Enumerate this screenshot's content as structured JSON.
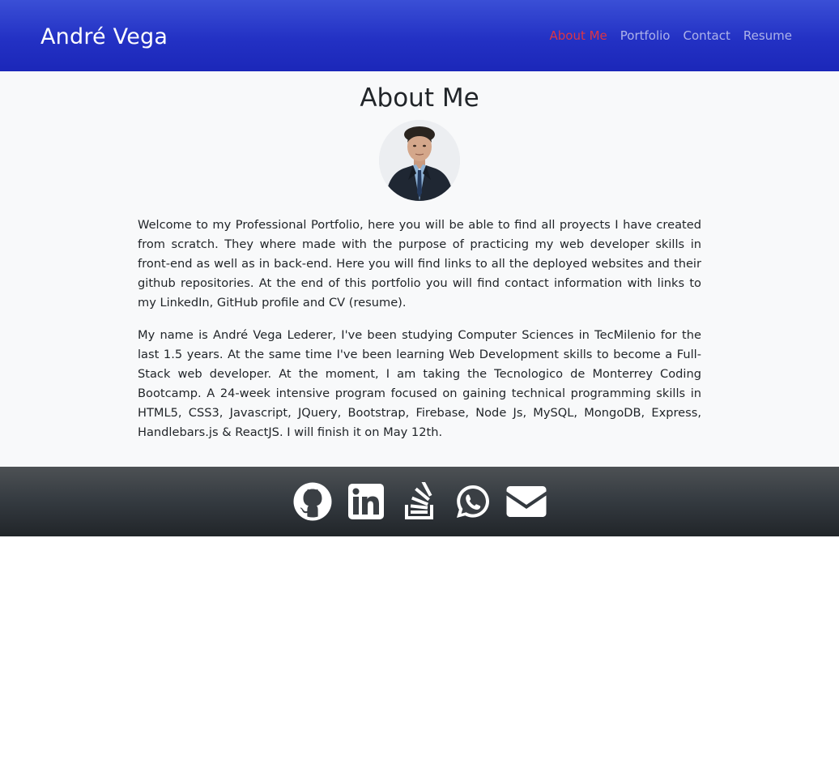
{
  "navbar": {
    "brand": "André Vega",
    "links": [
      {
        "label": "About Me",
        "active": true
      },
      {
        "label": "Portfolio",
        "active": false
      },
      {
        "label": "Contact",
        "active": false
      },
      {
        "label": "Resume",
        "active": false
      }
    ]
  },
  "main": {
    "title": "About Me",
    "avatar_icon": "profile-photo",
    "paragraphs": [
      "Welcome to my Professional Portfolio, here you will be able to find all proyects I have created from scratch. They where made with the purpose of practicing my web developer skills in front-end as well as in back-end. Here you will find links to all the deployed websites and their github repositories. At the end of this portfolio you will find contact information with links to my LinkedIn, GitHub profile and CV (resume).",
      "My name is André Vega Lederer, I've been studying Computer Sciences in TecMilenio for the last 1.5 years. At the same time I've been learning Web Development skills to become a Full-Stack web developer. At the moment, I am taking the Tecnologico de Monterrey Coding Bootcamp. A 24-week intensive program focused on gaining technical programming skills in HTML5, CSS3, Javascript, JQuery, Bootstrap, Firebase, Node Js, MySQL, MongoDB, Express, Handlebars.js & ReactJS. I will finish it on May 12th."
    ]
  },
  "footer": {
    "icons": [
      "github-icon",
      "linkedin-icon",
      "stack-overflow-icon",
      "whatsapp-icon",
      "envelope-icon"
    ]
  },
  "colors": {
    "navbar": "#2331c4",
    "active_link": "#dc3545",
    "main_bg": "#f8f9fa",
    "footer": "#343a40"
  }
}
